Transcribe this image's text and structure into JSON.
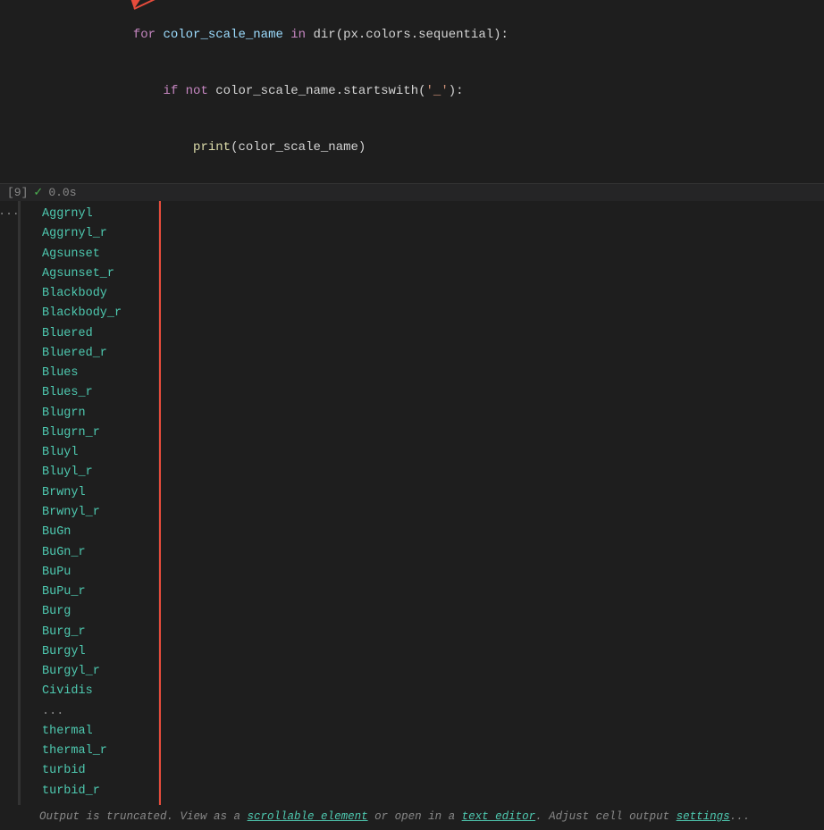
{
  "code": {
    "lines": [
      {
        "indent": "    ",
        "tokens": [
          {
            "text": "for",
            "cls": "kw"
          },
          {
            "text": " color_scale_name ",
            "cls": ""
          },
          {
            "text": "in",
            "cls": "kw"
          },
          {
            "text": " dir(px.colors.sequential):",
            "cls": ""
          }
        ]
      },
      {
        "indent": "        ",
        "tokens": [
          {
            "text": "if",
            "cls": "kw"
          },
          {
            "text": " ",
            "cls": ""
          },
          {
            "text": "not",
            "cls": "kw"
          },
          {
            "text": " color_scale_name.startswith(",
            "cls": ""
          },
          {
            "text": "'_'",
            "cls": "str"
          },
          {
            "text": "):",
            "cls": ""
          }
        ]
      },
      {
        "indent": "            ",
        "tokens": [
          {
            "text": "print",
            "cls": "fn"
          },
          {
            "text": "(color_scale_name)",
            "cls": ""
          }
        ]
      }
    ],
    "cell_num": "[9]",
    "cell_time": "0.0s"
  },
  "output": {
    "items": [
      "Aggrnyl",
      "Aggrnyl_r",
      "Agsunset",
      "Agsunset_r",
      "Blackbody",
      "Blackbody_r",
      "Bluered",
      "Bluered_r",
      "Blues",
      "Blues_r",
      "Blugrn",
      "Blugrn_r",
      "Bluyl",
      "Bluyl_r",
      "Brwnyl",
      "Brwnyl_r",
      "BuGn",
      "BuGn_r",
      "BuPu",
      "BuPu_r",
      "Burg",
      "Burg_r",
      "Burgyl",
      "Burgyl_r",
      "Cividis",
      "...",
      "thermal",
      "thermal_r",
      "turbid",
      "turbid_r"
    ],
    "truncated_text": "Output is truncated. View as a ",
    "scrollable_link": "scrollable element",
    "or_text": " or open in a ",
    "editor_link": "text editor",
    "adjust_text": ". Adjust cell output ",
    "settings_link": "settings",
    "end_text": "..."
  },
  "icons": {
    "check": "✓",
    "dots": "..."
  }
}
